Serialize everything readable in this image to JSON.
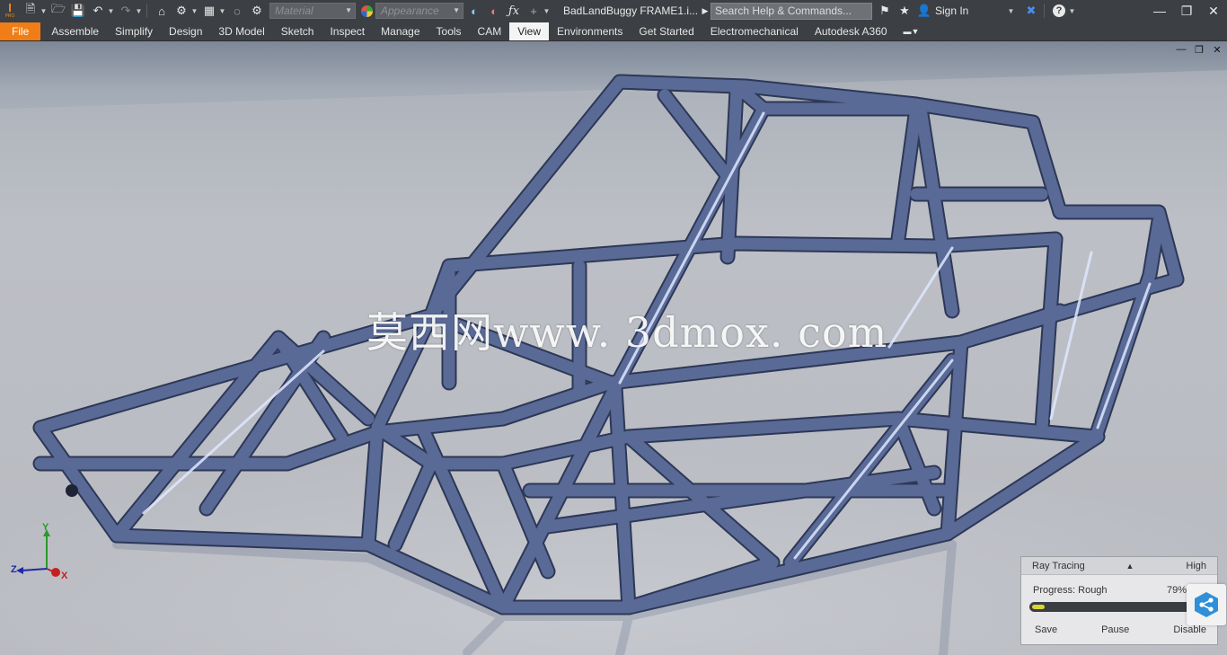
{
  "app": {
    "doc_title": "BadLandBuggy FRAME1.i...",
    "search_placeholder": "Search Help & Commands...",
    "sign_in": "Sign In",
    "material_combo": "Material",
    "appearance_combo": "Appearance",
    "logo_text": "PRO"
  },
  "ribbon": {
    "file_tab": "File",
    "tabs": [
      "Assemble",
      "Simplify",
      "Design",
      "3D Model",
      "Sketch",
      "Inspect",
      "Manage",
      "Tools",
      "CAM",
      "View",
      "Environments",
      "Get Started",
      "Electromechanical",
      "Autodesk A360"
    ],
    "active_tab": "View"
  },
  "viewport": {
    "watermark": "莫西网www. 3dmox. com"
  },
  "triad": {
    "x": "X",
    "y": "Y",
    "z": "Z"
  },
  "ray_tracing": {
    "title": "Ray Tracing",
    "quality": "High",
    "progress_label": "Progress: Rough",
    "progress_value": "79%",
    "progress_fraction": 0.04,
    "buttons": {
      "save": "Save",
      "pause": "Pause",
      "disable": "Disable"
    }
  },
  "colors": {
    "file_tab": "#f07d16",
    "titlebar": "#3c3f43",
    "tube": "#4d5d88",
    "progress_fill": "#d9d433"
  }
}
